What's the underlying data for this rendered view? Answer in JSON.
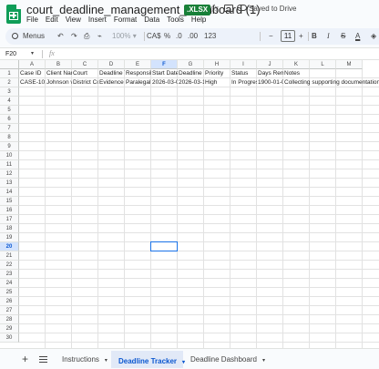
{
  "titlebar": {
    "doc_title": "court_deadline_management_dashboard (1)",
    "format_badge": ".XLSX",
    "saved_status": "Saved to Drive",
    "star_icon": "star-outline-icon",
    "folder_icon": "move-folder-icon",
    "cloud_icon": "cloud-saved-icon"
  },
  "menu": [
    "File",
    "Edit",
    "View",
    "Insert",
    "Format",
    "Data",
    "Tools",
    "Help"
  ],
  "toolbar": {
    "menus_label": "Menus",
    "undo": "↶",
    "redo": "↷",
    "print": "⎙",
    "paint_format": "⌁",
    "zoom": "100%",
    "zoom_caret": "▾",
    "currency": "CA$",
    "percent": "%",
    "dec_decrease": ".0",
    "dec_increase": ".00",
    "number_format": "123",
    "font_decrease": "−",
    "font_size": "11",
    "font_increase": "+",
    "bold": "B",
    "italic": "I",
    "strike": "S",
    "text_color": "A",
    "fill": "◈"
  },
  "formula_bar": {
    "name_box": "F20",
    "fx": "fx",
    "value": ""
  },
  "grid": {
    "columns": [
      "A",
      "B",
      "C",
      "D",
      "E",
      "F",
      "G",
      "H",
      "I",
      "J",
      "K",
      "L",
      "M"
    ],
    "selected_column": "F",
    "rows": [
      "1",
      "2",
      "3",
      "4",
      "5",
      "6",
      "7",
      "8",
      "9",
      "10",
      "11",
      "12",
      "13",
      "14",
      "15",
      "16",
      "17",
      "18",
      "19",
      "20",
      "21",
      "22",
      "23",
      "24",
      "25",
      "26",
      "27",
      "28",
      "29",
      "30"
    ],
    "selected_row": "20",
    "header_row": [
      "Case ID",
      "Client Name",
      "Court",
      "Deadline Type",
      "Responsible",
      "Start Date",
      "Deadline Date",
      "Priority",
      "Status",
      "Days Remaining",
      "Notes",
      "",
      ""
    ],
    "row2": [
      "CASE-101",
      "Johnson v. Smith",
      "District Court",
      "Evidence",
      "Paralegal",
      "2026-03-01",
      "2026-03-15",
      "High",
      "In Progress",
      "1900-01-0",
      "Collecting supporting documentation",
      "",
      ""
    ],
    "selected_cell": "F20"
  },
  "sheets": {
    "add_label": "+",
    "list_label": "≡",
    "tabs": [
      {
        "label": "Instructions",
        "active": false
      },
      {
        "label": "Deadline Tracker",
        "active": true
      },
      {
        "label": "Deadline Dashboard",
        "active": false
      }
    ],
    "caret": "▾"
  }
}
